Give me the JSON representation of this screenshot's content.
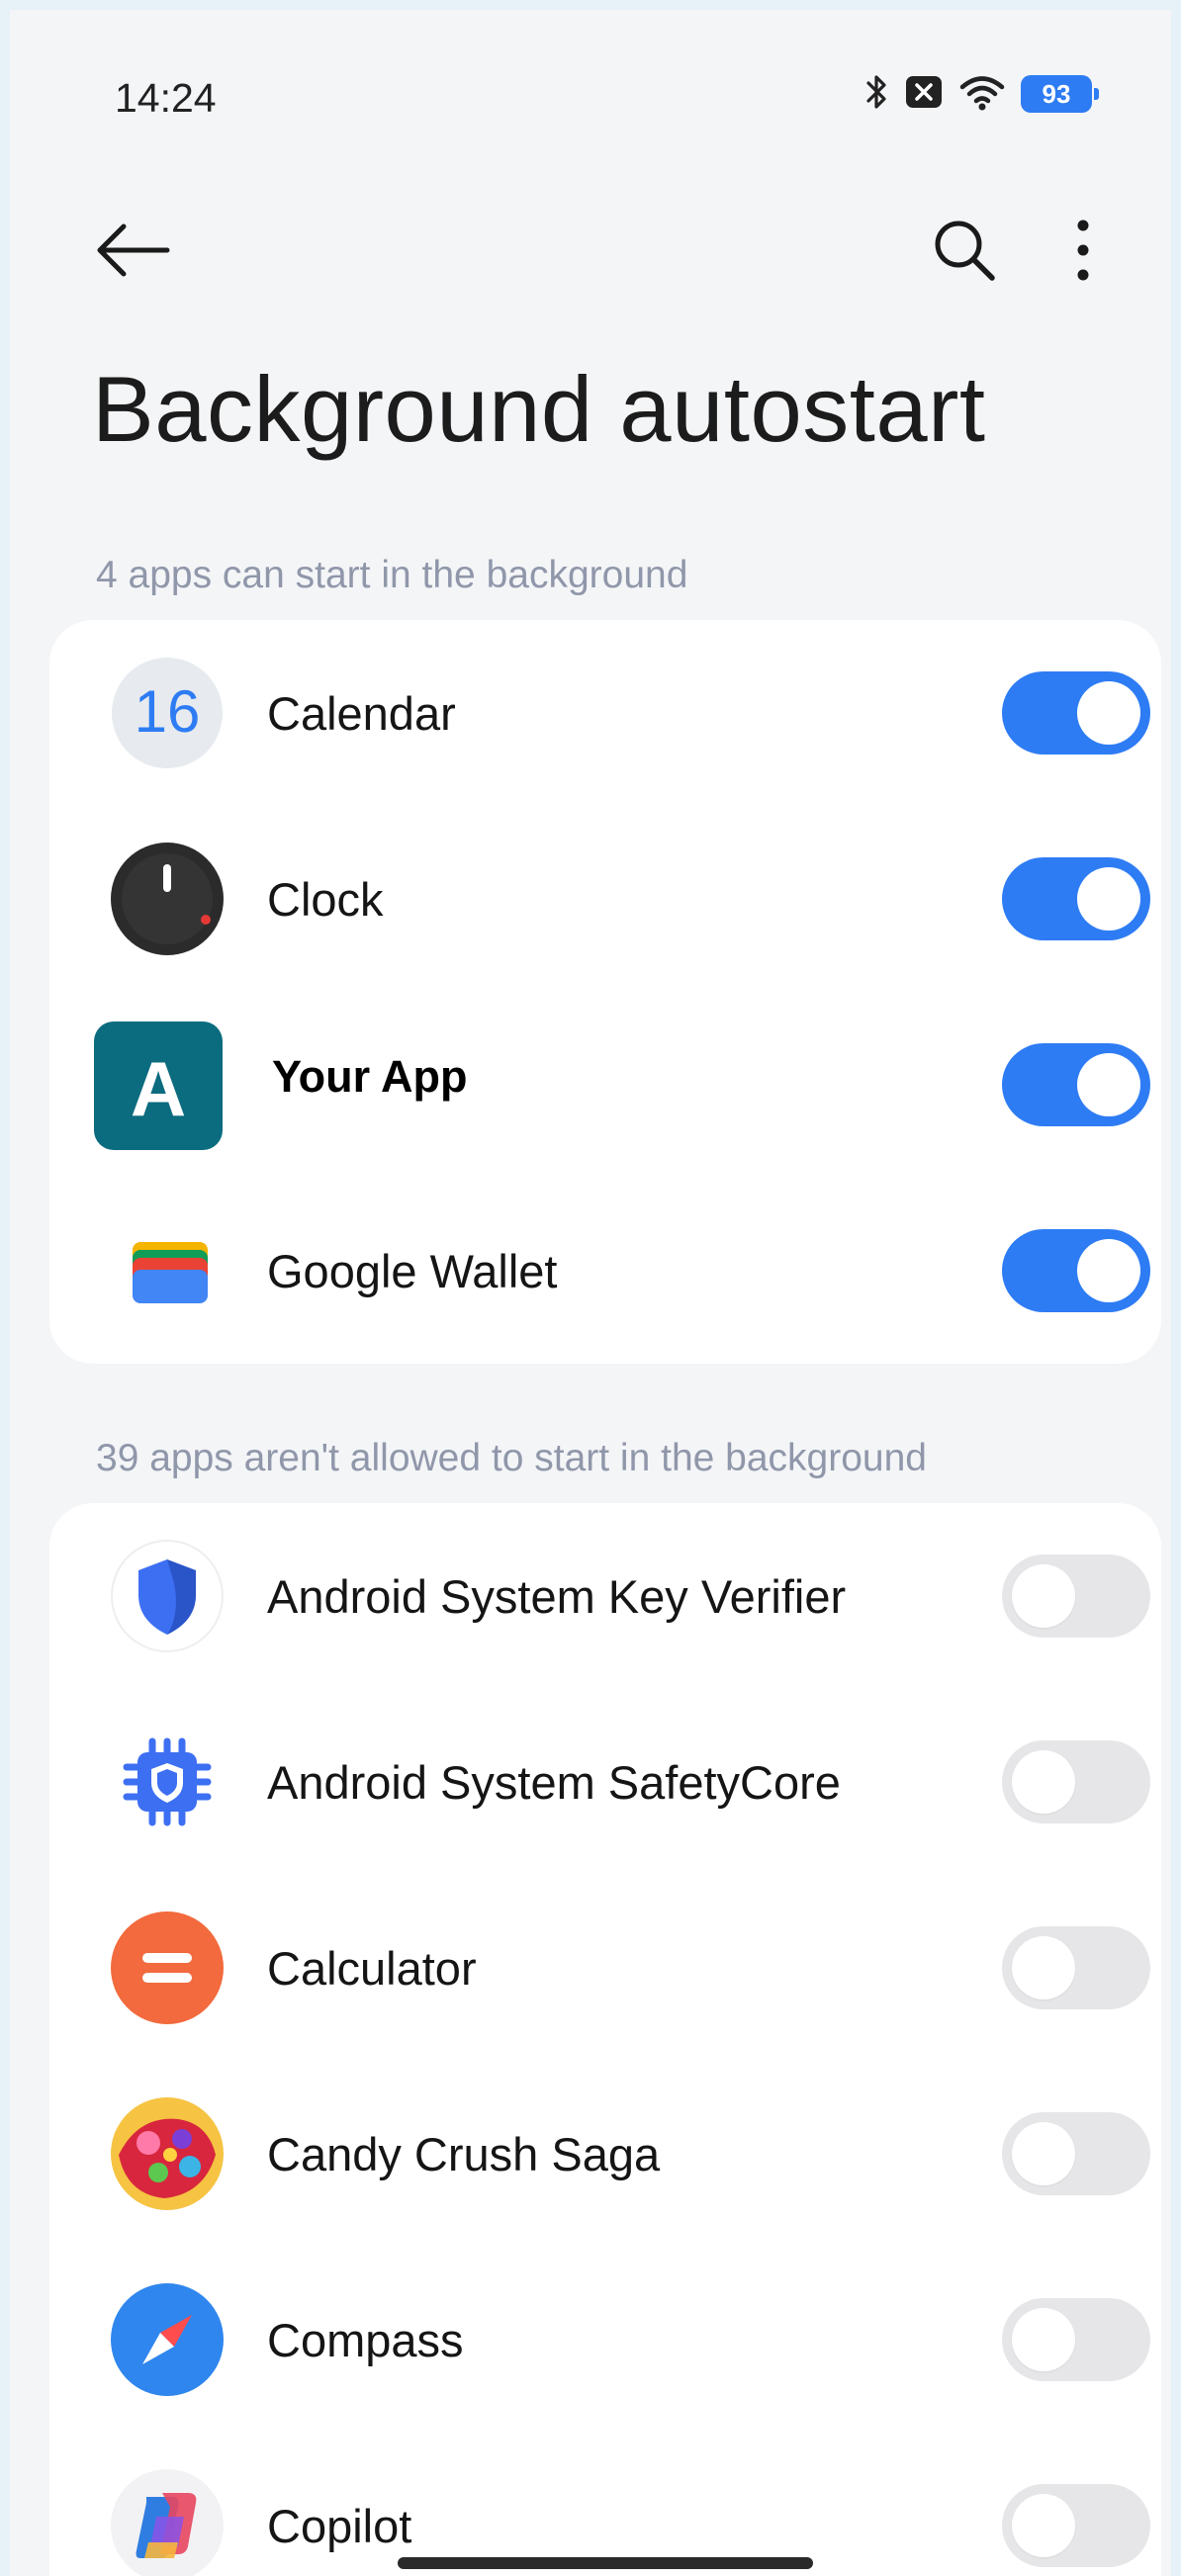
{
  "status_bar": {
    "time": "14:24",
    "battery": "93"
  },
  "header": {
    "title": "Background autostart"
  },
  "allowed_section": {
    "label": "4 apps can start in the background",
    "apps": [
      {
        "name": "Calendar",
        "icon": "calendar-icon",
        "icon_text": "16",
        "enabled": true
      },
      {
        "name": "Clock",
        "icon": "clock-icon",
        "enabled": true
      },
      {
        "name": "Your App",
        "icon": "your-app-icon",
        "icon_text": "A",
        "enabled": true
      },
      {
        "name": "Google Wallet",
        "icon": "google-wallet-icon",
        "enabled": true
      }
    ]
  },
  "disallowed_section": {
    "label": "39 apps aren't allowed to start in the background",
    "apps": [
      {
        "name": "Android System Key Verifier",
        "icon": "shield-icon",
        "enabled": false
      },
      {
        "name": "Android System SafetyCore",
        "icon": "chip-shield-icon",
        "enabled": false
      },
      {
        "name": "Calculator",
        "icon": "calculator-icon",
        "enabled": false
      },
      {
        "name": "Candy Crush Saga",
        "icon": "candy-crush-icon",
        "enabled": false
      },
      {
        "name": "Compass",
        "icon": "compass-icon",
        "enabled": false
      },
      {
        "name": "Copilot",
        "icon": "copilot-icon",
        "enabled": false
      }
    ]
  },
  "colors": {
    "accent": "#2E7CF4",
    "toggle_off": "#E6E6E8",
    "section_label": "#9097AA",
    "background": "#F4F5F7"
  }
}
